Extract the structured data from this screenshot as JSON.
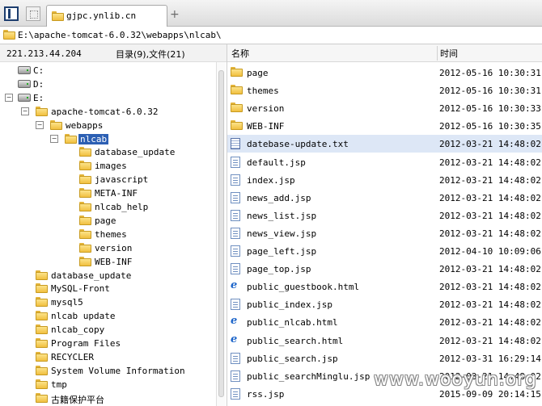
{
  "tab": {
    "title": "gjpc.ynlib.cn",
    "add": "+"
  },
  "path": "E:\\apache-tomcat-6.0.32\\webapps\\nlcab\\",
  "info": {
    "ip": "221.213.44.204",
    "counts": "目录(9),文件(21)"
  },
  "columns": {
    "name": "名称",
    "time": "时间"
  },
  "tree": [
    {
      "label": "C:",
      "kind": "drive",
      "exp": "",
      "depth": 0
    },
    {
      "label": "D:",
      "kind": "drive",
      "exp": "",
      "depth": 0
    },
    {
      "label": "E:",
      "kind": "drive",
      "exp": "−",
      "depth": 0
    },
    {
      "label": "apache-tomcat-6.0.32",
      "kind": "folder",
      "exp": "−",
      "depth": 1
    },
    {
      "label": "webapps",
      "kind": "folder",
      "exp": "−",
      "depth": 2
    },
    {
      "label": "nlcab",
      "kind": "folder",
      "exp": "−",
      "depth": 3,
      "selected": true
    },
    {
      "label": "database_update",
      "kind": "folder",
      "exp": "",
      "depth": 4
    },
    {
      "label": "images",
      "kind": "folder",
      "exp": "",
      "depth": 4
    },
    {
      "label": "javascript",
      "kind": "folder",
      "exp": "",
      "depth": 4
    },
    {
      "label": "META-INF",
      "kind": "folder",
      "exp": "",
      "depth": 4
    },
    {
      "label": "nlcab_help",
      "kind": "folder",
      "exp": "",
      "depth": 4
    },
    {
      "label": "page",
      "kind": "folder",
      "exp": "",
      "depth": 4
    },
    {
      "label": "themes",
      "kind": "folder",
      "exp": "",
      "depth": 4
    },
    {
      "label": "version",
      "kind": "folder",
      "exp": "",
      "depth": 4
    },
    {
      "label": "WEB-INF",
      "kind": "folder",
      "exp": "",
      "depth": 4
    },
    {
      "label": "database_update",
      "kind": "folder",
      "exp": "",
      "depth": 1
    },
    {
      "label": "MySQL-Front",
      "kind": "folder",
      "exp": "",
      "depth": 1
    },
    {
      "label": "mysql5",
      "kind": "folder",
      "exp": "",
      "depth": 1
    },
    {
      "label": "nlcab update",
      "kind": "folder",
      "exp": "",
      "depth": 1
    },
    {
      "label": "nlcab_copy",
      "kind": "folder",
      "exp": "",
      "depth": 1
    },
    {
      "label": "Program Files",
      "kind": "folder",
      "exp": "",
      "depth": 1
    },
    {
      "label": "RECYCLER",
      "kind": "folder",
      "exp": "",
      "depth": 1
    },
    {
      "label": "System Volume Information",
      "kind": "folder",
      "exp": "",
      "depth": 1
    },
    {
      "label": "tmp",
      "kind": "folder",
      "exp": "",
      "depth": 1
    },
    {
      "label": "古籍保护平台",
      "kind": "folder",
      "exp": "",
      "depth": 1
    }
  ],
  "files": [
    {
      "name": "page",
      "time": "2012-05-16 10:30:31",
      "type": "folder"
    },
    {
      "name": "themes",
      "time": "2012-05-16 10:30:31",
      "type": "folder"
    },
    {
      "name": "version",
      "time": "2012-05-16 10:30:33",
      "type": "folder"
    },
    {
      "name": "WEB-INF",
      "time": "2012-05-16 10:30:35",
      "type": "folder"
    },
    {
      "name": "datebase-update.txt",
      "time": "2012-03-21 14:48:02",
      "type": "txt",
      "selected": true
    },
    {
      "name": "default.jsp",
      "time": "2012-03-21 14:48:02",
      "type": "file"
    },
    {
      "name": "index.jsp",
      "time": "2012-03-21 14:48:02",
      "type": "file"
    },
    {
      "name": "news_add.jsp",
      "time": "2012-03-21 14:48:02",
      "type": "file"
    },
    {
      "name": "news_list.jsp",
      "time": "2012-03-21 14:48:02",
      "type": "file"
    },
    {
      "name": "news_view.jsp",
      "time": "2012-03-21 14:48:02",
      "type": "file"
    },
    {
      "name": "page_left.jsp",
      "time": "2012-04-10 10:09:06",
      "type": "file"
    },
    {
      "name": "page_top.jsp",
      "time": "2012-03-21 14:48:02",
      "type": "file"
    },
    {
      "name": "public_guestbook.html",
      "time": "2012-03-21 14:48:02",
      "type": "html"
    },
    {
      "name": "public_index.jsp",
      "time": "2012-03-21 14:48:02",
      "type": "file"
    },
    {
      "name": "public_nlcab.html",
      "time": "2012-03-21 14:48:02",
      "type": "html"
    },
    {
      "name": "public_search.html",
      "time": "2012-03-21 14:48:02",
      "type": "html"
    },
    {
      "name": "public_search.jsp",
      "time": "2012-03-31 16:29:14",
      "type": "file"
    },
    {
      "name": "public_searchMinglu.jsp",
      "time": "2012-03-21 14:48:02",
      "type": "file"
    },
    {
      "name": "rss.jsp",
      "time": "2015-09-09 20:14:15",
      "type": "file"
    }
  ],
  "watermark": "www.wooyun.org"
}
